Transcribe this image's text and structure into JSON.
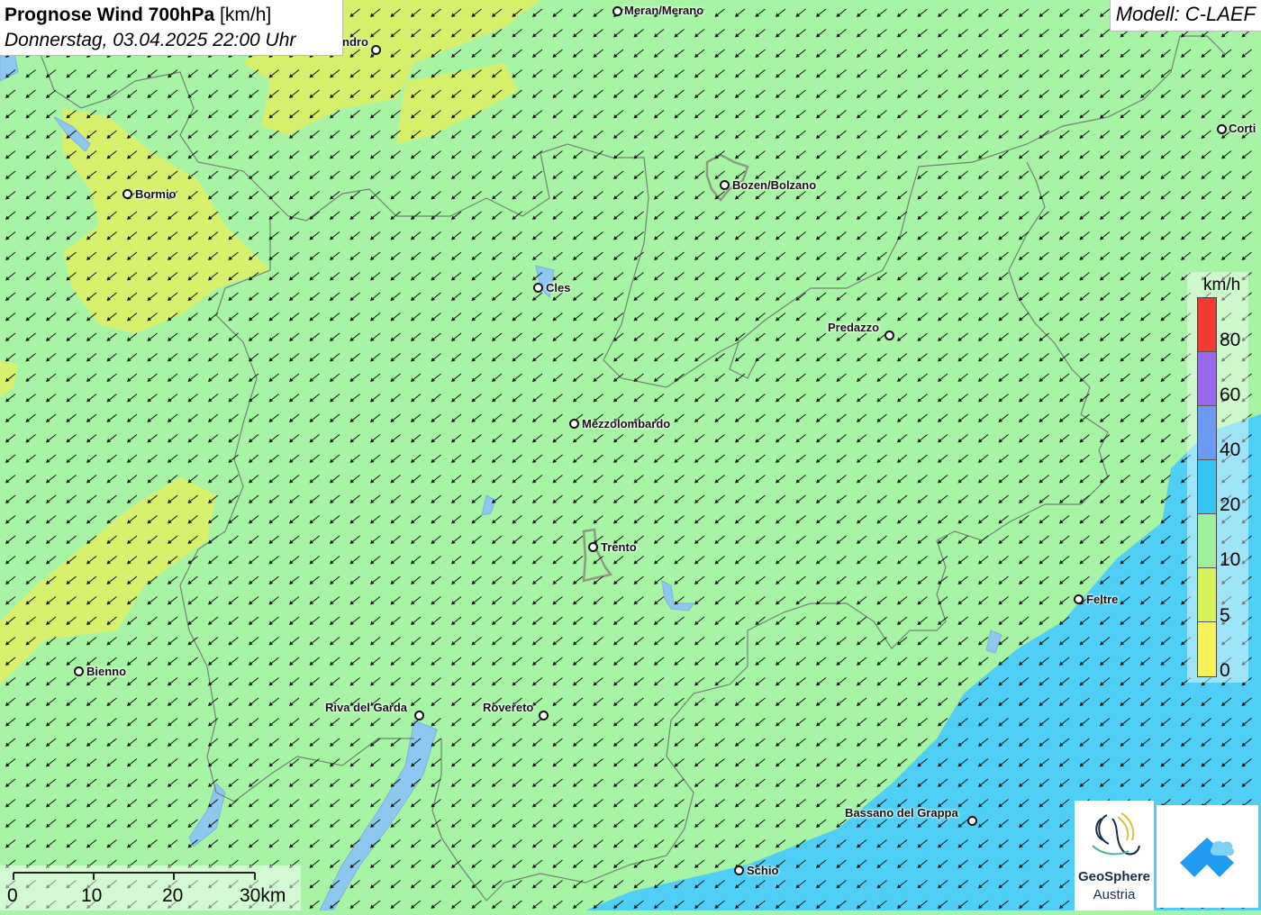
{
  "title": {
    "main": "Prognose Wind 700hPa",
    "unit": "[km/h]",
    "datetime": "Donnerstag, 03.04.2025 22:00 Uhr"
  },
  "model": "Modell: C-LAEF",
  "cities": [
    {
      "name": "Meran/Merano"
    },
    {
      "name": "ndro"
    },
    {
      "name": "Bormio"
    },
    {
      "name": "Bozen/Bolzano"
    },
    {
      "name": "Corti"
    },
    {
      "name": "Cles"
    },
    {
      "name": "Predazzo"
    },
    {
      "name": "Mezzolombardo"
    },
    {
      "name": "Trento"
    },
    {
      "name": "Feltre"
    },
    {
      "name": "Bienno"
    },
    {
      "name": "Riva del Garda"
    },
    {
      "name": "Rovereto"
    },
    {
      "name": "Bassano del Grappa"
    },
    {
      "name": "Schio"
    }
  ],
  "legend": {
    "title": "km/h",
    "labels": [
      "80",
      "60",
      "40",
      "20",
      "10",
      "5",
      "0"
    ],
    "colors": [
      "#f23a33",
      "#9966ee",
      "#6a9af2",
      "#33c6f2",
      "#9ef09c",
      "#d6f25a",
      "#f6f25a"
    ]
  },
  "scale_bar": {
    "labels": [
      "0",
      "10",
      "20",
      "30km"
    ]
  },
  "logos": {
    "geosphere_name": "GeoSphere",
    "geosphere_sub": "Austria"
  },
  "colors": {
    "background_green": "#a7f5a4",
    "yellow_zone": "#d9f06a",
    "blue_zone": "#4fcff6",
    "arrow": "#111111"
  },
  "wind_direction": "from northeast"
}
